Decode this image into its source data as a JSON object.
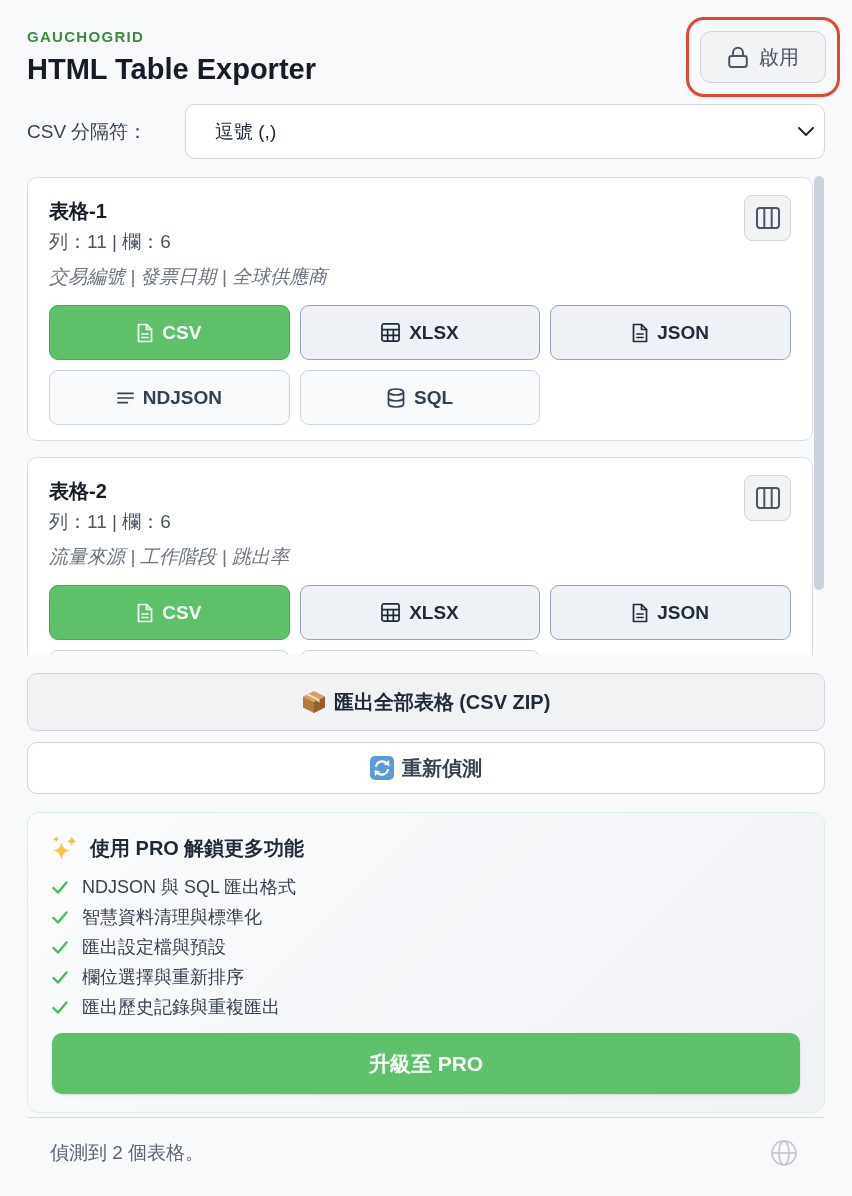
{
  "header": {
    "brand": "GAUCHOGRID",
    "title": "HTML Table Exporter",
    "activate_button": {
      "label": "啟用",
      "highlighted": true
    }
  },
  "delimiter": {
    "label": "CSV 分隔符：",
    "value": "逗號 (,)"
  },
  "tables": [
    {
      "name": "表格-1",
      "meta": "列：11 | 欄：6",
      "columns": "交易編號 | 發票日期 | 全球供應商",
      "formats": [
        {
          "label": "CSV",
          "selected": true,
          "locked": false
        },
        {
          "label": "XLSX",
          "selected": false,
          "locked": false
        },
        {
          "label": "JSON",
          "selected": false,
          "locked": false
        },
        {
          "label": "NDJSON",
          "selected": false,
          "locked": true
        },
        {
          "label": "SQL",
          "selected": false,
          "locked": true
        }
      ]
    },
    {
      "name": "表格-2",
      "meta": "列：11 | 欄：6",
      "columns": "流量來源 | 工作階段 | 跳出率",
      "formats": [
        {
          "label": "CSV",
          "selected": true,
          "locked": false
        },
        {
          "label": "XLSX",
          "selected": false,
          "locked": false
        },
        {
          "label": "JSON",
          "selected": false,
          "locked": false
        },
        {
          "selected": false,
          "locked": true
        },
        {
          "selected": false,
          "locked": true
        }
      ]
    }
  ],
  "actions": {
    "export_all": "匯出全部表格 (CSV ZIP)",
    "redetect": "重新偵測"
  },
  "pro": {
    "title": "使用 PRO 解鎖更多功能",
    "features": [
      "NDJSON 與 SQL 匯出格式",
      "智慧資料清理與標準化",
      "匯出設定檔與預設",
      "欄位選擇與重新排序",
      "匯出歷史記錄與重複匯出"
    ],
    "upgrade_button": "升級至 PRO"
  },
  "status_bar": {
    "text": "偵測到 2 個表格。"
  }
}
